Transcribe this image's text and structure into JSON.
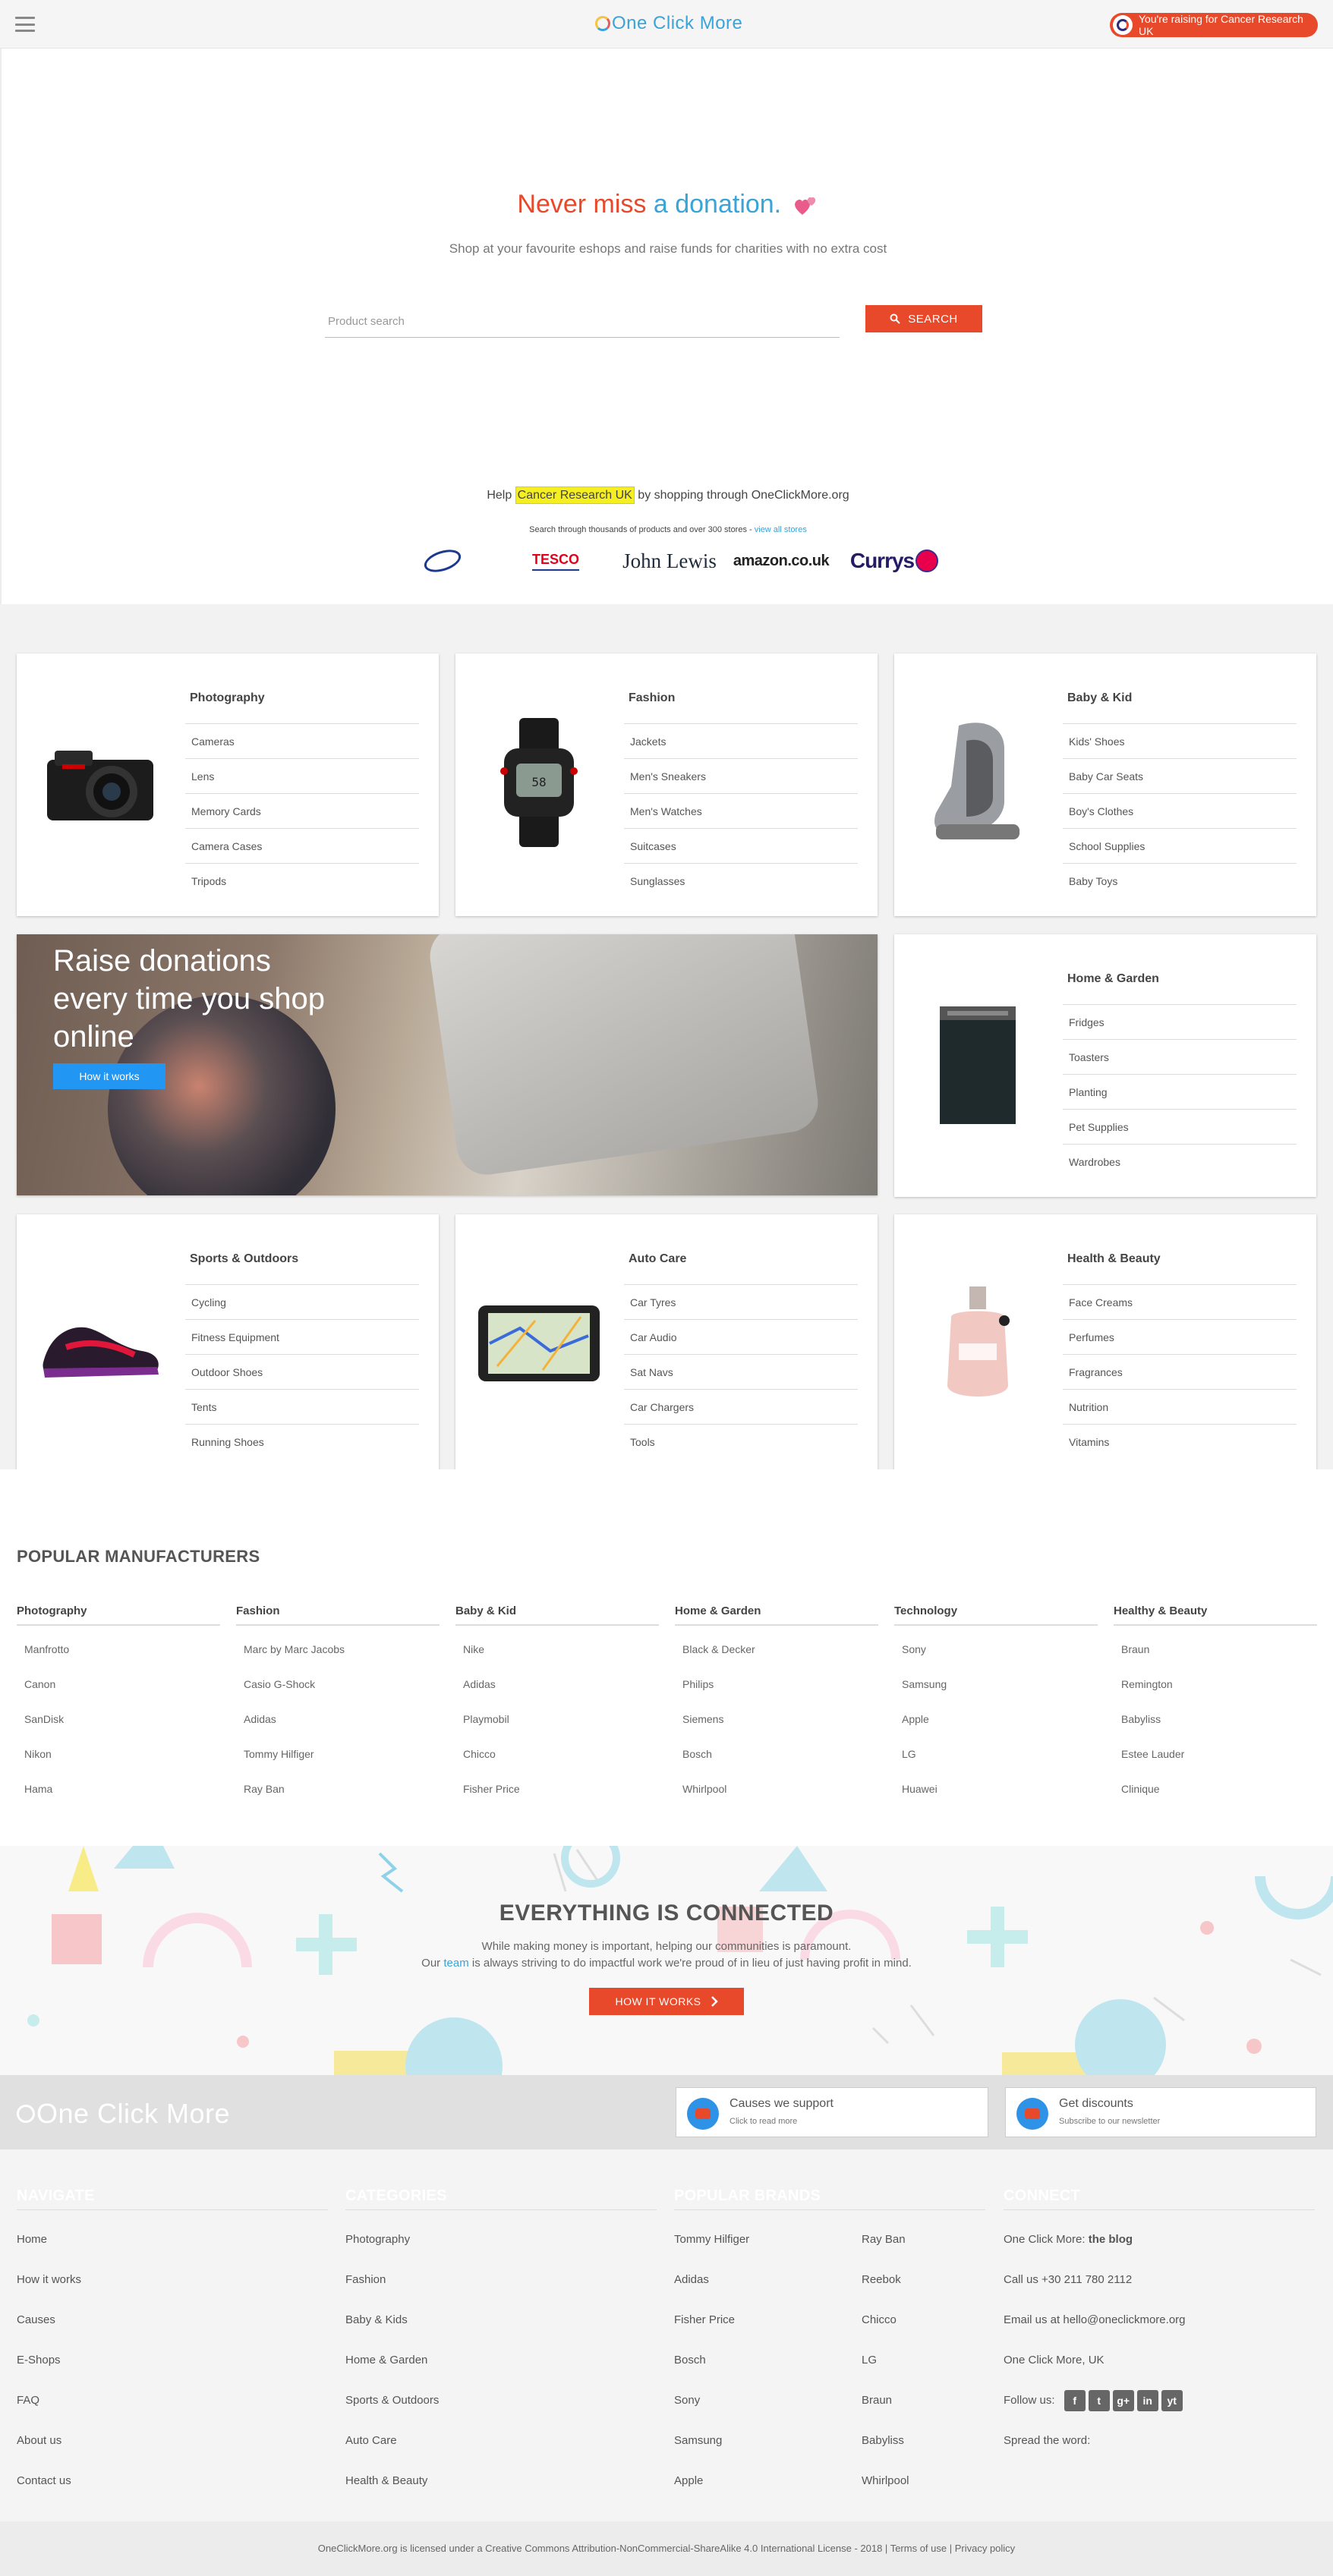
{
  "header": {
    "logo": "One Click More",
    "raising_text": "You're raising for Cancer Research UK"
  },
  "hero": {
    "title_part1": "Never miss ",
    "title_part2": "a donation.",
    "subtitle": "Shop at your favourite eshops and raise funds for charities with no extra cost",
    "search_placeholder": "Product search",
    "search_button": "SEARCH",
    "help_before": "Help ",
    "help_charity": "Cancer Research UK",
    "help_after": " by shopping through OneClickMore.org",
    "help_sub": "Search through thousands of products and over 300 stores - ",
    "help_sub_link": "view all stores",
    "stores": [
      "Boots",
      "TESCO",
      "John Lewis",
      "amazon.co.uk",
      "Currys"
    ]
  },
  "categories": [
    {
      "title": "Photography",
      "icon": "camera-icon",
      "items": [
        "Cameras",
        "Lens",
        "Memory Cards",
        "Camera Cases",
        "Tripods"
      ]
    },
    {
      "title": "Fashion",
      "icon": "watch-icon",
      "items": [
        "Jackets",
        "Men's Sneakers",
        "Men's Watches",
        "Suitcases",
        "Sunglasses"
      ]
    },
    {
      "title": "Baby & Kid",
      "icon": "car-seat-icon",
      "items": [
        "Kids' Shoes",
        "Baby Car Seats",
        "Boy's Clothes",
        "School Supplies",
        "Baby Toys"
      ]
    },
    {
      "title": "Home & Garden",
      "icon": "dishwasher-icon",
      "items": [
        "Fridges",
        "Toasters",
        "Planting",
        "Pet Supplies",
        "Wardrobes"
      ]
    },
    {
      "title": "Sports & Outdoors",
      "icon": "sneaker-icon",
      "items": [
        "Cycling",
        "Fitness Equipment",
        "Outdoor Shoes",
        "Tents",
        "Running Shoes"
      ]
    },
    {
      "title": "Auto Care",
      "icon": "sat-nav-icon",
      "items": [
        "Car Tyres",
        "Car Audio",
        "Sat Navs",
        "Car Chargers",
        "Tools"
      ]
    },
    {
      "title": "Health & Beauty",
      "icon": "perfume-icon",
      "items": [
        "Face Creams",
        "Perfumes",
        "Fragrances",
        "Nutrition",
        "Vitamins"
      ]
    }
  ],
  "banner": {
    "text": "Raise donations every time you shop online",
    "button": "How it works"
  },
  "manufacturers": {
    "title": "POPULAR MANUFACTURERS",
    "columns": [
      {
        "title": "Photography",
        "items": [
          "Manfrotto",
          "Canon",
          "SanDisk",
          "Nikon",
          "Hama"
        ]
      },
      {
        "title": "Fashion",
        "items": [
          "Marc by Marc Jacobs",
          "Casio G-Shock",
          "Adidas",
          "Tommy Hilfiger",
          "Ray Ban"
        ]
      },
      {
        "title": "Baby & Kid",
        "items": [
          "Nike",
          "Adidas",
          "Playmobil",
          "Chicco",
          "Fisher Price"
        ]
      },
      {
        "title": "Home & Garden",
        "items": [
          "Black & Decker",
          "Philips",
          "Siemens",
          "Bosch",
          "Whirlpool"
        ]
      },
      {
        "title": "Technology",
        "items": [
          "Sony",
          "Samsung",
          "Apple",
          "LG",
          "Huawei"
        ]
      },
      {
        "title": "Healthy & Beauty",
        "items": [
          "Braun",
          "Remington",
          "Babyliss",
          "Estee Lauder",
          "Clinique"
        ]
      }
    ]
  },
  "connected": {
    "title": "EVERYTHING IS CONNECTED",
    "line1": "While making money is important, helping our communities is paramount.",
    "line2_before": "Our ",
    "line2_link": "team",
    "line2_after": " is always striving to do impactful work we're proud of in lieu of just having profit in mind.",
    "button": "HOW IT WORKS"
  },
  "band": {
    "logo": "One Click More",
    "card1_title": "Causes we support",
    "card1_sub": "Click to read more",
    "card2_title": "Get discounts",
    "card2_sub": "Subscribe to our newsletter"
  },
  "footer": {
    "navigate_title": "NAVIGATE",
    "navigate": [
      "Home",
      "How it works",
      "Causes",
      "E-Shops",
      "FAQ",
      "About us",
      "Contact us"
    ],
    "categories_title": "CATEGORIES",
    "categories": [
      "Photography",
      "Fashion",
      "Baby & Kids",
      "Home & Garden",
      "Sports & Outdoors",
      "Auto Care",
      "Health & Beauty"
    ],
    "brands_title": "POPULAR BRANDS",
    "brands_col1": [
      "Tommy Hilfiger",
      "Adidas",
      "Fisher Price",
      "Bosch",
      "Sony",
      "Samsung",
      "Apple"
    ],
    "brands_col2": [
      "Ray Ban",
      "Reebok",
      "Chicco",
      "LG",
      "Braun",
      "Babyliss",
      "Whirlpool"
    ],
    "connect_title": "CONNECT",
    "blog_prefix": "One Click More: ",
    "blog_link": "the blog",
    "phone": "Call us +30 211 780 2112",
    "email": "Email us at hello@oneclickmore.org",
    "location": "One Click More, UK",
    "follow": "Follow us:",
    "social": [
      "f",
      "t",
      "g+",
      "in",
      "yt"
    ],
    "spread": "Spread the word:"
  },
  "copyright": {
    "text": "OneClickMore.org is licensed under a Creative Commons Attribution-NonCommercial-ShareAlike 4.0 International License - 2018 | ",
    "terms": "Terms of use",
    "sep": " | ",
    "privacy": "Privacy policy"
  },
  "colors": {
    "accent": "#e8492a",
    "blue": "#3aa3d8",
    "button_blue": "#2196f3"
  }
}
